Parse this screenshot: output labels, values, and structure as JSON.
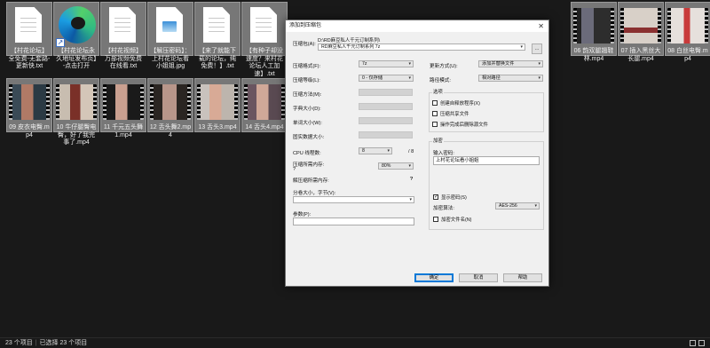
{
  "explorer": {
    "files": [
      {
        "name": "【村花论坛】全免费-无套路-更新快.txt",
        "kind": "text-document"
      },
      {
        "name": "【村花论坛永久地址发布页】-点击打开",
        "kind": "edge-shortcut"
      },
      {
        "name": "【村花视频】万部视频免费在线看.txt",
        "kind": "text-document"
      },
      {
        "name": "【解压密码】：上村花论坛看小姐姐.jpg",
        "kind": "image-document"
      },
      {
        "name": "【来了就能下载的论坛，纯免费！】.txt",
        "kind": "text-document"
      },
      {
        "name": "【有种子却没速度？来村花论坛人工加速】.txt",
        "kind": "text-document"
      },
      {
        "name": "06 韵双腿翘鞋林.mp4",
        "kind": "video"
      },
      {
        "name": "07 插入黑丝大长腿.mp4",
        "kind": "video"
      },
      {
        "name": "08 白丝电臀.mp4",
        "kind": "video"
      },
      {
        "name": "09 皮衣电臀.mp4",
        "kind": "video"
      },
      {
        "name": "10 牛仔腿臀电臀，好了我完事了.mp4",
        "kind": "video"
      },
      {
        "name": "11 千元五头舞1.mp4",
        "kind": "video"
      },
      {
        "name": "12 舌头舞2.mp4",
        "kind": "video"
      },
      {
        "name": "13 舌头3.mp4",
        "kind": "video"
      },
      {
        "name": "14 舌头4.mp4",
        "kind": "video"
      }
    ]
  },
  "statusbar": {
    "item_count": "23 个项目",
    "selected": "已选择 23 个项目"
  },
  "dialog": {
    "title": "添加到压缩包",
    "close_glyph": "✕",
    "archive_label": "压缩包(A):",
    "archive_path": "D:\\RD麻豆私人千元订制系列\\",
    "archive_name": "RD麻豆私人千元订制系列 7z",
    "browse_label": "...",
    "format_label": "压缩格式(F):",
    "format_value": "7z",
    "level_label": "压缩等级(L):",
    "level_value": "0 - 仅存储",
    "method_label": "压缩方法(M):",
    "dict_label": "字典大小(D):",
    "word_label": "单词大小(W):",
    "solid_label": "固实数据大小:",
    "cpu_label": "CPU 线程数:",
    "cpu_value": "8",
    "cpu_total": "/ 8",
    "mem_compress_label": "压缩所需内存:",
    "mem_compress_sub": "?",
    "mem_compress_value": "80%",
    "mem_compress_right": "?",
    "mem_decompress_label": "解压缩所需内存:",
    "mem_decompress_value": "?",
    "split_label": "分卷大小，字节(V):",
    "params_label": "参数(P):",
    "update_label": "更新方式(U):",
    "update_value": "添加并替换文件",
    "path_mode_label": "路径模式:",
    "path_mode_value": "相对路径",
    "options_title": "选项",
    "opt_sfx": "创建自释放程序(X)",
    "opt_shared": "压缩共享文件",
    "opt_delete": "操作完成后删除源文件",
    "encrypt_title": "加密",
    "password_label": "输入密码:",
    "password_value": "上村花论坛看小姐姐",
    "show_password": "显示密码(S)",
    "show_password_check": "✓",
    "enc_method_label": "加密算法:",
    "enc_method_value": "AES-256",
    "encrypt_names": "加密文件名(N)",
    "ok": "确定",
    "cancel": "取消",
    "help": "帮助"
  }
}
